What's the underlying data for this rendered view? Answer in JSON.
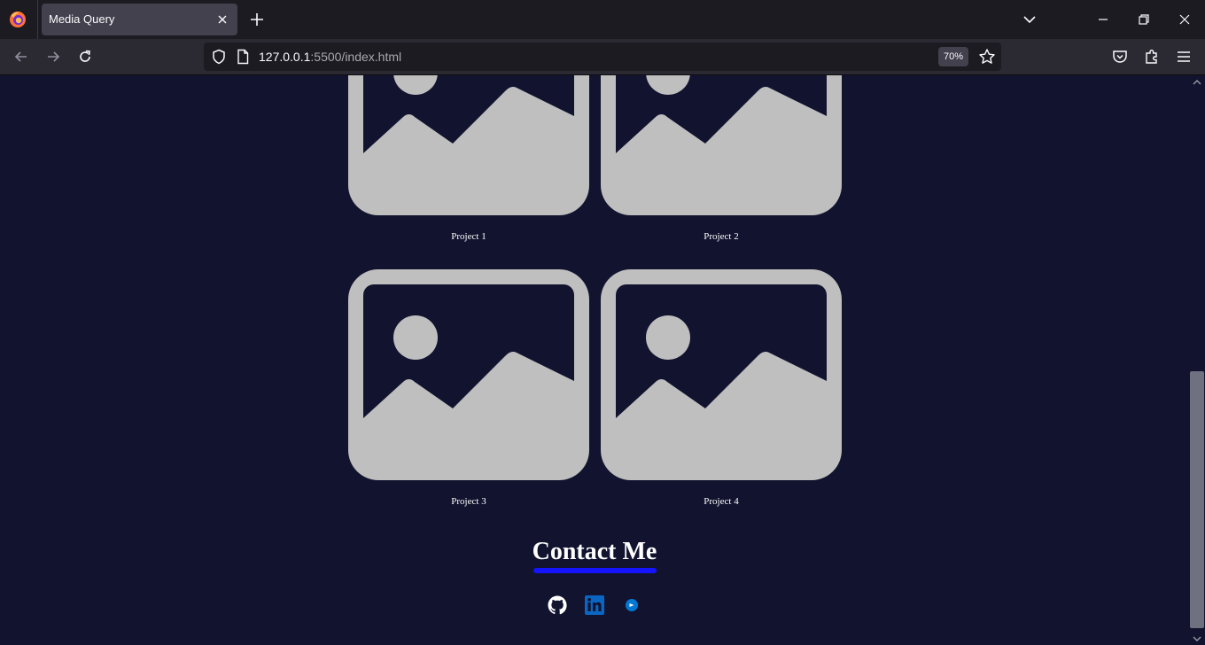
{
  "browser": {
    "tab_title": "Media Query",
    "url_host": "127.0.0.1",
    "url_rest": ":5500/index.html",
    "zoom": "70%"
  },
  "projects": [
    {
      "label": "Project 1"
    },
    {
      "label": "Project 2"
    },
    {
      "label": "Project 3"
    },
    {
      "label": "Project 4"
    }
  ],
  "contact": {
    "title": "Contact Me",
    "links": [
      {
        "icon": "github-icon"
      },
      {
        "icon": "linkedin-icon"
      },
      {
        "icon": "email-icon"
      }
    ]
  },
  "colors": {
    "page_background": "#11132f",
    "placeholder_gray": "#bfbfbf",
    "underline_blue": "#1414ff",
    "linkedin_blue": "#0a66c2"
  }
}
